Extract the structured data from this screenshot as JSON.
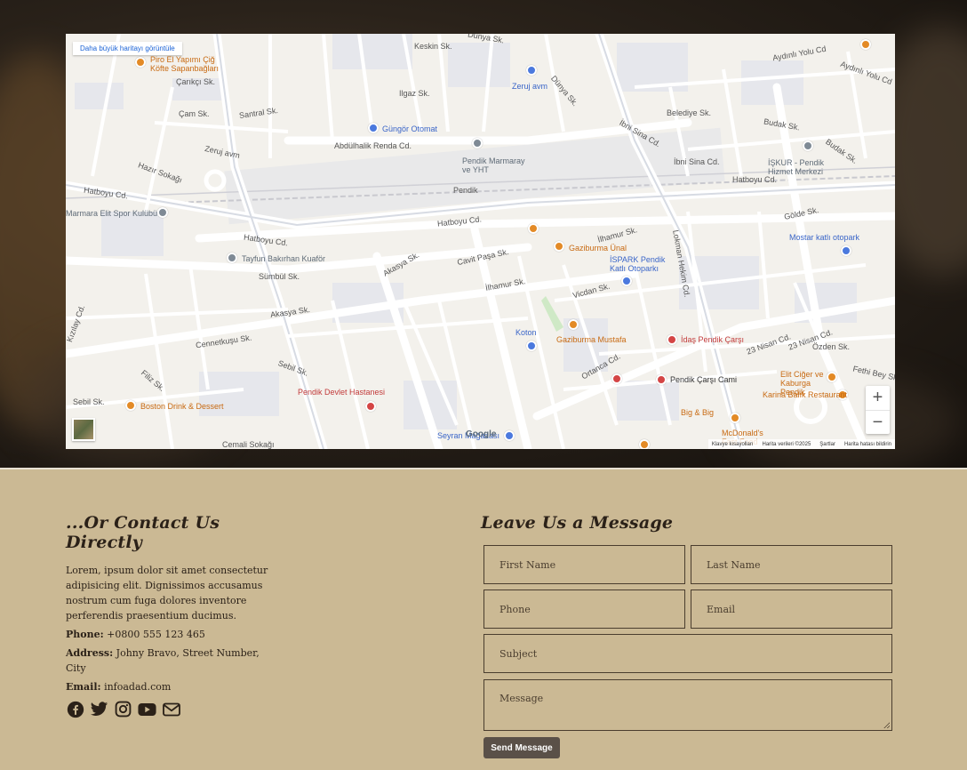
{
  "map": {
    "larger_map_link": "Daha büyük haritayı görüntüle",
    "zoom_in": "+",
    "zoom_out": "−",
    "google_logo": "Google",
    "attribution": {
      "shortcuts": "Klavye kısayolları",
      "map_data": "Harita verileri ©2025",
      "terms": "Şartlar",
      "report": "Harita hatası bildirin"
    },
    "places": [
      {
        "name": "Piro El Yapımı Çiğ Köfte Sapanbağları",
        "kind": "poi-o"
      },
      {
        "name": "Çarıkçı Sk.",
        "kind": "street"
      },
      {
        "name": "Zeruj avm",
        "kind": "poi-b"
      },
      {
        "name": "Güngör Otomat",
        "kind": "poi-b"
      },
      {
        "name": "Abdülhalik Renda Cd.",
        "kind": "street"
      },
      {
        "name": "Pendik Marmaray ve YHT",
        "kind": "poi-g"
      },
      {
        "name": "Pendik",
        "kind": "street"
      },
      {
        "name": "Hatboyu Cd.",
        "kind": "street"
      },
      {
        "name": "Marmara Elit Spor Kulübü",
        "kind": "poi-g"
      },
      {
        "name": "Tayfun Bakırhan Kuaför",
        "kind": "poi-g"
      },
      {
        "name": "Gaziburma Ünal",
        "kind": "poi-o"
      },
      {
        "name": "İSPARK Pendik Katlı Otoparkı",
        "kind": "poi-b"
      },
      {
        "name": "Mostar katlı otopark",
        "kind": "poi-b"
      },
      {
        "name": "İŞKUR - Pendik Hizmet Merkezi",
        "kind": "poi-g"
      },
      {
        "name": "Koton",
        "kind": "poi-b"
      },
      {
        "name": "Gaziburma Mustafa",
        "kind": "poi-o"
      },
      {
        "name": "İdaş Pendik Çarşı",
        "kind": "poi-r"
      },
      {
        "name": "Pendik Çarşı Cami",
        "kind": "poi-g"
      },
      {
        "name": "Elit Ciğer ve Kaburga Pendik",
        "kind": "poi-o"
      },
      {
        "name": "Karina Balık Restaurant",
        "kind": "poi-o"
      },
      {
        "name": "Pendik Devlet Hastanesi",
        "kind": "poi-r"
      },
      {
        "name": "Boston Drink & Dessert",
        "kind": "poi-o"
      },
      {
        "name": "Big & Big",
        "kind": "poi-o"
      },
      {
        "name": "McDonald's Fast Food",
        "kind": "poi-o"
      },
      {
        "name": "Seyran Mağazası",
        "kind": "poi-b"
      },
      {
        "name": "Cemali Sokağı",
        "kind": "street"
      },
      {
        "name": "Akasya Sk.",
        "kind": "street"
      },
      {
        "name": "Sümbül Sk.",
        "kind": "street"
      },
      {
        "name": "İlhamur Sk.",
        "kind": "street"
      },
      {
        "name": "Lokman Hekim Cd.",
        "kind": "street"
      },
      {
        "name": "Gölde Sk.",
        "kind": "street"
      },
      {
        "name": "23 Nisan Cd.",
        "kind": "street"
      },
      {
        "name": "Özden Sk.",
        "kind": "street"
      },
      {
        "name": "Fethi Bey Sk.",
        "kind": "street"
      },
      {
        "name": "Aydınlı Yolu Cd",
        "kind": "street"
      },
      {
        "name": "Budak Sk.",
        "kind": "street"
      },
      {
        "name": "Belediye Sk.",
        "kind": "street"
      },
      {
        "name": "İbni Sina Cd.",
        "kind": "street"
      },
      {
        "name": "Santral Sk.",
        "kind": "street"
      },
      {
        "name": "Çam Sk.",
        "kind": "street"
      },
      {
        "name": "Hazır Sokağı",
        "kind": "street"
      },
      {
        "name": "Cennetkuşu Sk.",
        "kind": "street"
      },
      {
        "name": "Sebil Sk.",
        "kind": "street"
      },
      {
        "name": "Filiz Sk.",
        "kind": "street"
      },
      {
        "name": "Kızılay Cd.",
        "kind": "street"
      },
      {
        "name": "Ilgaz Sk.",
        "kind": "street"
      },
      {
        "name": "Keskin Sk.",
        "kind": "street"
      },
      {
        "name": "Dünya Sk.",
        "kind": "street"
      },
      {
        "name": "Ortanca Cd.",
        "kind": "street"
      },
      {
        "name": "Cavit Paşa Sk.",
        "kind": "street"
      },
      {
        "name": "Vicdan Sk.",
        "kind": "street"
      }
    ]
  },
  "contact": {
    "heading": "...Or Contact Us Directly",
    "intro": "Lorem, ipsum dolor sit amet consectetur adipisicing elit. Dignissimos accusamus nostrum cum fuga dolores inventore perferendis praesentium ducimus.",
    "phone_label": "Phone:",
    "phone": "+0800 555 123 465",
    "address_label": "Address:",
    "address": "Johny Bravo, Street Number, City",
    "email_label": "Email:",
    "email": "infoadad.com",
    "socials": [
      "facebook-icon",
      "twitter-icon",
      "instagram-icon",
      "youtube-icon",
      "envelope-icon"
    ]
  },
  "form": {
    "heading": "Leave Us a Message",
    "first_name": "First Name",
    "last_name": "Last Name",
    "phone": "Phone",
    "email": "Email",
    "subject": "Subject",
    "message": "Message",
    "submit": "Send Message"
  },
  "colors": {
    "section_bg": "#cbb994",
    "text_dark": "#2b2118",
    "button_bg": "#5a5048"
  }
}
